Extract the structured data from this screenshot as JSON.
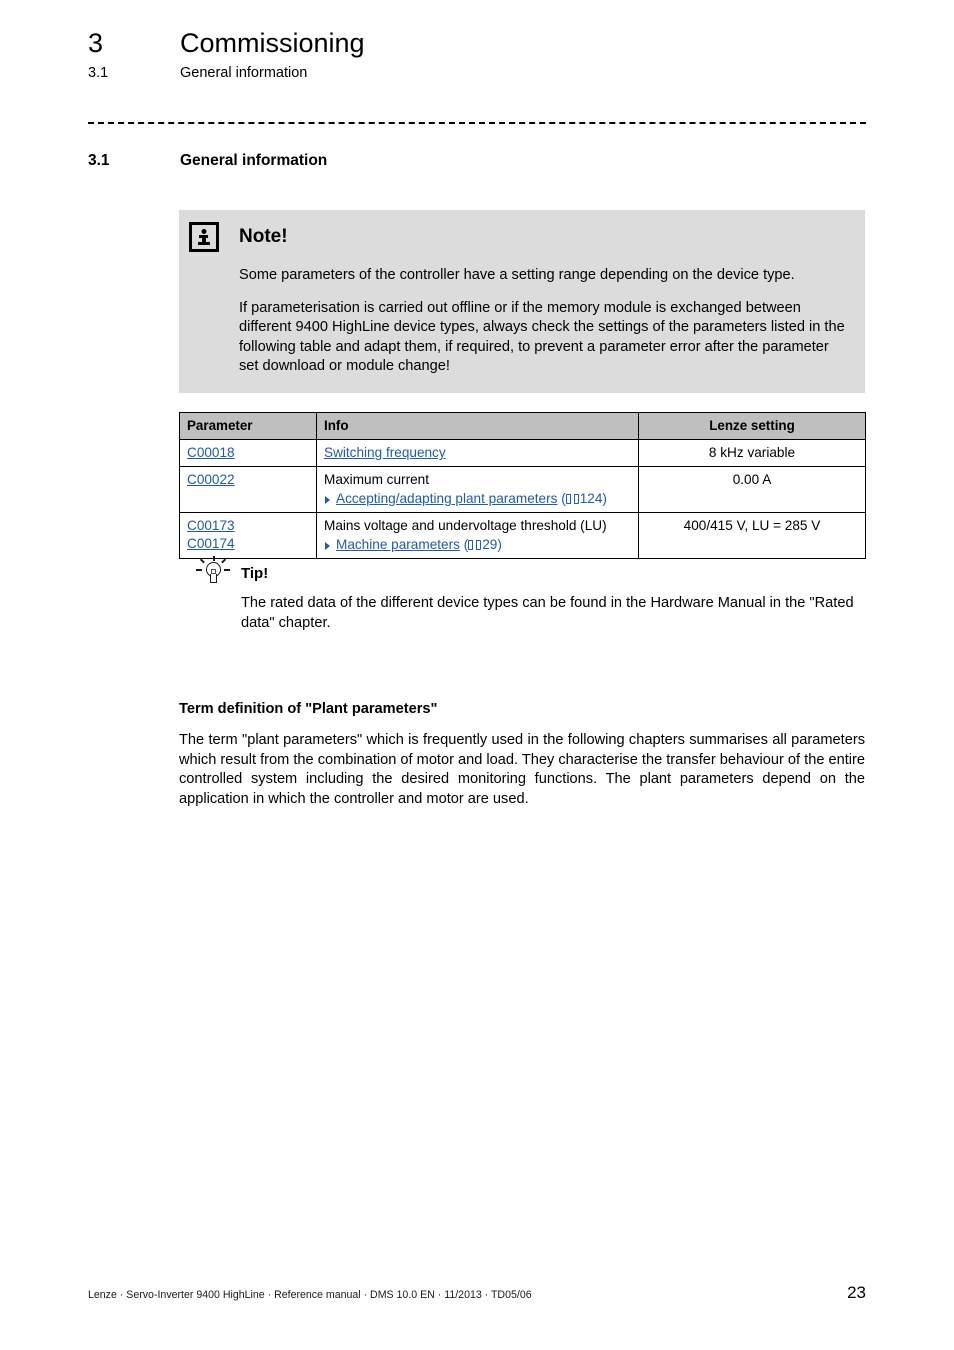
{
  "running_header": {
    "chapter_number": "3",
    "chapter_title": "Commissioning",
    "section_number": "3.1",
    "section_title": "General information"
  },
  "section_heading": {
    "number": "3.1",
    "title": "General information"
  },
  "note": {
    "icon": "info-icon",
    "title": "Note!",
    "paragraph_1": "Some parameters of the controller have a setting range depending on the device type.",
    "paragraph_2": "If parameterisation is carried out offline or if the memory module is exchanged between different 9400 HighLine device types, always check the settings of the parameters listed in the following table and adapt them, if required, to prevent a parameter error after the parameter set download or module change!",
    "background_color": "#dcdcdc"
  },
  "table": {
    "header_background": "#bfbfbf",
    "link_color": "#1f5ba8",
    "columns": [
      "Parameter",
      "Info",
      "Lenze setting"
    ],
    "rows": [
      {
        "parameter": [
          "C00018"
        ],
        "info_text": "",
        "info_link": "Switching frequency",
        "xref": null,
        "xref_page": null,
        "setting": "8 kHz variable"
      },
      {
        "parameter": [
          "C00022"
        ],
        "info_text": "Maximum current",
        "info_link": null,
        "xref": "Accepting/adapting plant parameters",
        "xref_page": "124",
        "setting": "0.00 A"
      },
      {
        "parameter": [
          "C00173",
          "C00174"
        ],
        "info_text": "Mains voltage and undervoltage threshold (LU)",
        "info_link": null,
        "xref": "Machine parameters",
        "xref_page": "29",
        "setting": "400/415 V, LU = 285 V"
      }
    ]
  },
  "tip": {
    "icon": "lightbulb-icon",
    "title": "Tip!",
    "body": "The rated data of the different device types can be found in the Hardware Manual in the \"Rated data\" chapter."
  },
  "term_definition": {
    "heading": "Term definition of \"Plant parameters\"",
    "body": "The term \"plant parameters\" which is frequently used in the following chapters summarises all parameters which result from the combination of motor and load. They characterise the transfer behaviour of the entire controlled system including the desired monitoring functions. The plant parameters depend on the application in which the controller and motor are used."
  },
  "footer": {
    "text": "Lenze · Servo-Inverter 9400 HighLine · Reference manual · DMS 10.0 EN · 11/2013 · TD05/06",
    "page_number": "23"
  }
}
